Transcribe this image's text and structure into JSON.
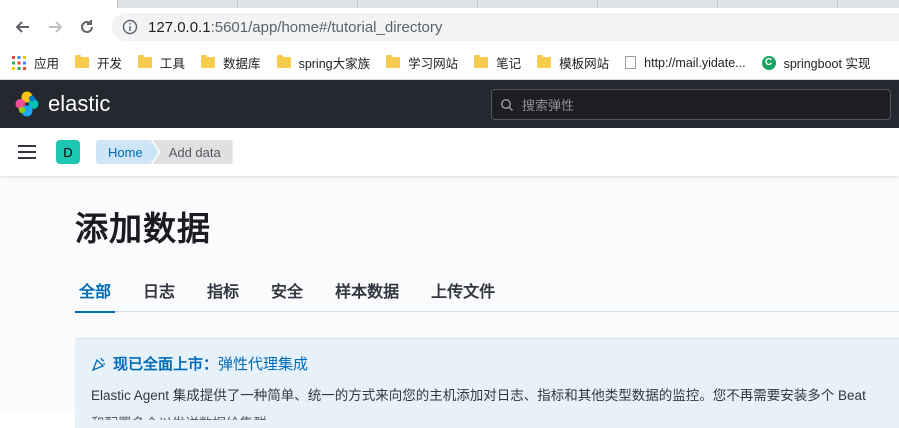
{
  "browser": {
    "url_host": "127.0.0.1",
    "url_rest": ":5601/app/home#/tutorial_directory",
    "bookmarks": [
      "应用",
      "开发",
      "工具",
      "数据库",
      "spring大家族",
      "学习网站",
      "笔记",
      "模板网站",
      "http://mail.yidate...",
      "springboot 实现"
    ]
  },
  "kibana": {
    "logo_text": "elastic",
    "search_placeholder": "搜索弹性",
    "space_initial": "D",
    "breadcrumbs": [
      "Home",
      "Add data"
    ]
  },
  "page": {
    "title": "添加数据",
    "tabs": [
      "全部",
      "日志",
      "指标",
      "安全",
      "样本数据",
      "上传文件"
    ],
    "callout_bold": "现已全面上市：",
    "callout_link": "弹性代理集成",
    "callout_text": "Elastic Agent 集成提供了一种简单、统一的方式来向您的主机添加对日志、指标和其他类型数据的监控。您不再需要安装多个 Beat",
    "callout_text2": "和配置多个以发送数据给集群"
  },
  "colors": {
    "header_bg": "#25282f",
    "accent_blue": "#006bb8",
    "space_avatar": "#1ec7b4",
    "callout_bg": "#e6f1fa"
  }
}
